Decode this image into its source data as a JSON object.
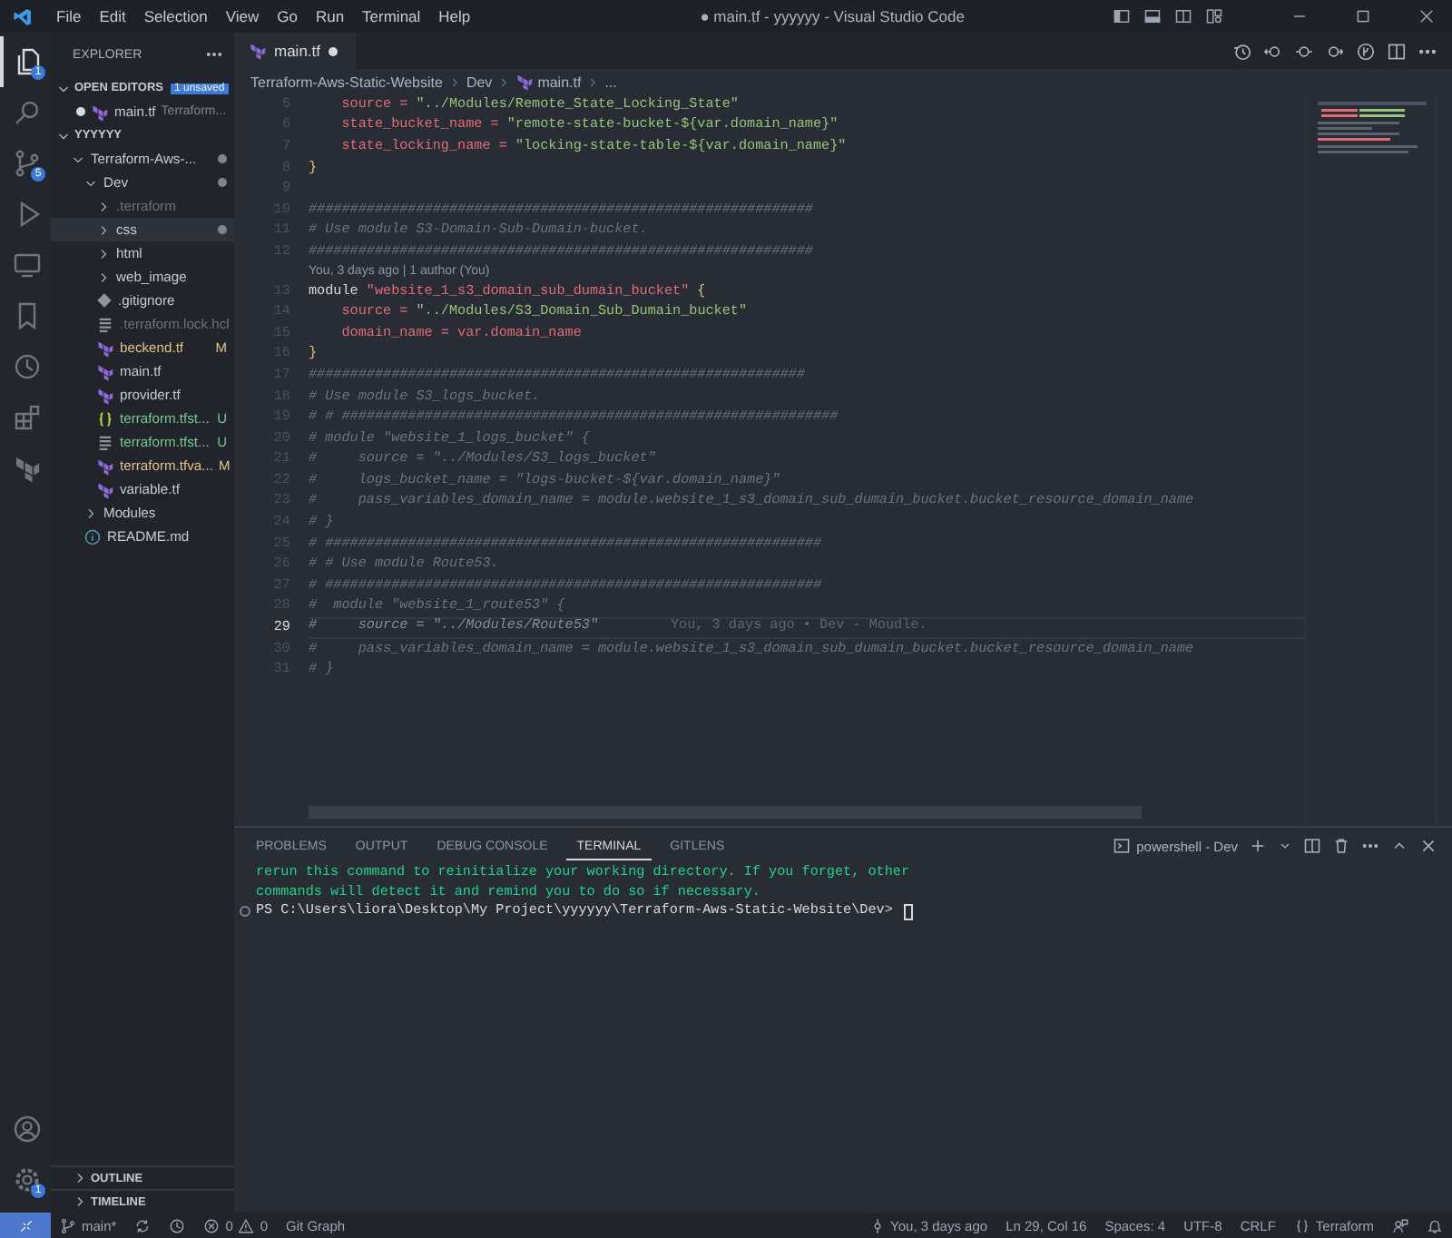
{
  "title_bar": {
    "menu": [
      "File",
      "Edit",
      "Selection",
      "View",
      "Go",
      "Run",
      "Terminal",
      "Help"
    ],
    "title": "● main.tf - yyyyyy - Visual Studio Code"
  },
  "activity_bar": {
    "items": [
      {
        "kind": "explorer",
        "selected": true,
        "badge": "1"
      },
      {
        "kind": "search",
        "selected": false
      },
      {
        "kind": "source-control",
        "selected": false,
        "badge": "5"
      },
      {
        "kind": "run",
        "selected": false
      },
      {
        "kind": "remote",
        "selected": false
      },
      {
        "kind": "bookmarks",
        "selected": false
      },
      {
        "kind": "gitlens",
        "selected": false
      },
      {
        "kind": "extensions",
        "selected": false
      },
      {
        "kind": "terraform",
        "selected": false
      }
    ],
    "bottom": [
      {
        "kind": "accounts"
      },
      {
        "kind": "settings",
        "badge": "1"
      }
    ]
  },
  "sidebar": {
    "title": "EXPLORER",
    "open_editors": {
      "label": "OPEN EDITORS",
      "expanded": true,
      "badge": "1 unsaved",
      "items": [
        {
          "name": "main.tf",
          "description": "Terraform...",
          "modified": true,
          "selected": false
        }
      ]
    },
    "workspace": {
      "label": "YYYYYY",
      "expanded": true,
      "tree": [
        {
          "name": "Terraform-Aws-...",
          "kind": "folder",
          "expanded": true,
          "modified": true,
          "selected": false,
          "children": [
            {
              "name": "Dev",
              "kind": "folder",
              "expanded": true,
              "modified": true,
              "selected": false,
              "children": [
                {
                  "name": ".terraform",
                  "kind": "folder",
                  "expanded": false,
                  "ignored": true,
                  "selected": false
                },
                {
                  "name": "css",
                  "kind": "folder",
                  "expanded": false,
                  "modified": true,
                  "selected": true
                },
                {
                  "name": "html",
                  "kind": "folder",
                  "expanded": false,
                  "selected": false
                },
                {
                  "name": "web_image",
                  "kind": "folder",
                  "expanded": false,
                  "selected": false
                },
                {
                  "name": ".gitignore",
                  "kind": "gitignore",
                  "selected": false
                },
                {
                  "name": ".terraform.lock.hcl",
                  "kind": "document",
                  "ignored": true,
                  "selected": false
                },
                {
                  "name": "beckend.tf",
                  "kind": "terraform",
                  "status": "M",
                  "color": "#e2c08d",
                  "selected": false
                },
                {
                  "name": "main.tf",
                  "kind": "terraform",
                  "selected": false
                },
                {
                  "name": "provider.tf",
                  "kind": "terraform",
                  "selected": false
                },
                {
                  "name": "terraform.tfst...",
                  "kind": "json",
                  "status": "U",
                  "color": "#73c991",
                  "selected": false
                },
                {
                  "name": "terraform.tfst...",
                  "kind": "document",
                  "status": "U",
                  "color": "#73c991",
                  "selected": false
                },
                {
                  "name": "terraform.tfva...",
                  "kind": "terraform",
                  "status": "M",
                  "color": "#e2c08d",
                  "selected": false
                },
                {
                  "name": "variable.tf",
                  "kind": "terraform",
                  "selected": false
                }
              ]
            },
            {
              "name": "Modules",
              "kind": "folder",
              "expanded": false,
              "selected": false
            },
            {
              "name": "README.md",
              "kind": "markdown",
              "selected": false
            }
          ]
        }
      ]
    },
    "outline": {
      "label": "OUTLINE",
      "expanded": false
    },
    "timeline": {
      "label": "TIMELINE",
      "expanded": false
    }
  },
  "editor": {
    "tabs": [
      {
        "name": "main.tf",
        "selected": true,
        "modified": true
      }
    ],
    "breadcrumbs": [
      "Terraform-Aws-Static-Website",
      "Dev",
      "main.tf",
      "..."
    ],
    "lines": [
      {
        "kind": "code",
        "number": "5",
        "current": false,
        "tokens": [
          {
            "kind": "prop",
            "text": "    source"
          },
          {
            "kind": "op",
            "text": " = "
          },
          {
            "kind": "str",
            "text": "\"../Modules/Remote_State_Locking_State\""
          }
        ]
      },
      {
        "kind": "code",
        "number": "6",
        "current": false,
        "tokens": [
          {
            "kind": "prop",
            "text": "    state_bucket_name"
          },
          {
            "kind": "op",
            "text": " = "
          },
          {
            "kind": "str",
            "text": "\"remote-state-bucket-${var.domain_name}\""
          }
        ]
      },
      {
        "kind": "code",
        "number": "7",
        "current": false,
        "tokens": [
          {
            "kind": "prop",
            "text": "    state_locking_name"
          },
          {
            "kind": "op",
            "text": " = "
          },
          {
            "kind": "str",
            "text": "\"locking-state-table-${var.domain_name}\""
          }
        ]
      },
      {
        "kind": "code",
        "number": "8",
        "current": false,
        "tokens": [
          {
            "kind": "brace",
            "text": "}"
          }
        ]
      },
      {
        "kind": "code",
        "number": "9",
        "current": false
      },
      {
        "kind": "code",
        "number": "10",
        "current": false,
        "tokens": [
          {
            "kind": "com",
            "text": "#############################################################"
          }
        ]
      },
      {
        "kind": "code",
        "number": "11",
        "current": false,
        "tokens": [
          {
            "kind": "com",
            "text": "# Use module S3-Domain-Sub-Dumain-bucket."
          }
        ]
      },
      {
        "kind": "code",
        "number": "12",
        "current": false,
        "tokens": [
          {
            "kind": "com",
            "text": "#############################################################"
          }
        ]
      },
      {
        "kind": "codelens",
        "text": "You, 3 days ago | 1 author (You)"
      },
      {
        "kind": "code",
        "number": "13",
        "current": false,
        "tokens": [
          {
            "kind": "kw",
            "text": "module"
          },
          {
            "kind": "prop",
            "text": " \"website_1_s3_domain_sub_dumain_bucket\""
          },
          {
            "kind": "brace",
            "text": " {"
          }
        ]
      },
      {
        "kind": "code",
        "number": "14",
        "current": false,
        "tokens": [
          {
            "kind": "prop",
            "text": "    source"
          },
          {
            "kind": "op",
            "text": " = "
          },
          {
            "kind": "str",
            "text": "\"../Modules/S3_Domain_Sub_Dumain_bucket\""
          }
        ]
      },
      {
        "kind": "code",
        "number": "15",
        "current": false,
        "tokens": [
          {
            "kind": "prop",
            "text": "    domain_name"
          },
          {
            "kind": "op",
            "text": " = "
          },
          {
            "kind": "prop",
            "text": "var.domain_name"
          }
        ]
      },
      {
        "kind": "code",
        "number": "16",
        "current": false,
        "tokens": [
          {
            "kind": "brace",
            "text": "}"
          }
        ]
      },
      {
        "kind": "code",
        "number": "17",
        "current": false,
        "tokens": [
          {
            "kind": "com",
            "text": "############################################################"
          }
        ]
      },
      {
        "kind": "code",
        "number": "18",
        "current": false,
        "tokens": [
          {
            "kind": "com",
            "text": "# Use module S3_logs_bucket."
          }
        ]
      },
      {
        "kind": "code",
        "number": "19",
        "current": false,
        "tokens": [
          {
            "kind": "com",
            "text": "# # ############################################################"
          }
        ]
      },
      {
        "kind": "code",
        "number": "20",
        "current": false,
        "tokens": [
          {
            "kind": "com",
            "text": "# module \"website_1_logs_bucket\" {"
          }
        ]
      },
      {
        "kind": "code",
        "number": "21",
        "current": false,
        "tokens": [
          {
            "kind": "com",
            "text": "#     source = \"../Modules/S3_logs_bucket\""
          }
        ]
      },
      {
        "kind": "code",
        "number": "22",
        "current": false,
        "tokens": [
          {
            "kind": "com",
            "text": "#     logs_bucket_name = \"logs-bucket-${var.domain_name}\""
          }
        ]
      },
      {
        "kind": "code",
        "number": "23",
        "current": false,
        "tokens": [
          {
            "kind": "com",
            "text": "#     pass_variables_domain_name = module.website_1_s3_domain_sub_dumain_bucket.bucket_resource_domain_name"
          }
        ]
      },
      {
        "kind": "code",
        "number": "24",
        "current": false,
        "tokens": [
          {
            "kind": "com",
            "text": "# }"
          }
        ]
      },
      {
        "kind": "code",
        "number": "25",
        "current": false,
        "tokens": [
          {
            "kind": "com",
            "text": "# ############################################################"
          }
        ]
      },
      {
        "kind": "code",
        "number": "26",
        "current": false,
        "tokens": [
          {
            "kind": "com",
            "text": "# # Use module Route53."
          }
        ]
      },
      {
        "kind": "code",
        "number": "27",
        "current": false,
        "tokens": [
          {
            "kind": "com",
            "text": "# ############################################################"
          }
        ]
      },
      {
        "kind": "code",
        "number": "28",
        "current": false,
        "tokens": [
          {
            "kind": "com",
            "text": "#  module \"website_1_route53\" {"
          }
        ]
      },
      {
        "kind": "code",
        "number": "29",
        "current": true,
        "tokens": [
          {
            "kind": "com",
            "text": "#     source = \"../Modules/Route53\""
          }
        ],
        "blame": "You, 3 days ago • Dev - Moudle."
      },
      {
        "kind": "code",
        "number": "30",
        "current": false,
        "tokens": [
          {
            "kind": "com",
            "text": "#     pass_variables_domain_name = module.website_1_s3_domain_sub_dumain_bucket.bucket_resource_domain_name"
          }
        ]
      },
      {
        "kind": "code",
        "number": "31",
        "current": false,
        "tokens": [
          {
            "kind": "com",
            "text": "# }"
          }
        ]
      }
    ]
  },
  "panel": {
    "tabs": [
      {
        "label": "PROBLEMS",
        "selected": false
      },
      {
        "label": "OUTPUT",
        "selected": false
      },
      {
        "label": "DEBUG CONSOLE",
        "selected": false
      },
      {
        "label": "TERMINAL",
        "selected": true
      },
      {
        "label": "GITLENS",
        "selected": false
      }
    ],
    "terminal_name": "powershell - Dev",
    "terminal_lines": [
      {
        "kind": "info",
        "text": "rerun this command to reinitialize your working directory. If you forget, other"
      },
      {
        "kind": "info",
        "text": "commands will detect it and remind you to do so if necessary."
      },
      {
        "kind": "prompt",
        "text": "PS C:\\Users\\liora\\Desktop\\My Project\\yyyyyy\\Terraform-Aws-Static-Website\\Dev>"
      }
    ]
  },
  "status_bar": {
    "branch": "main*",
    "errors": "0",
    "warnings": "0",
    "git_graph": "Git Graph",
    "blame": "You, 3 days ago",
    "position": "Ln 29, Col 16",
    "indent": "Spaces: 4",
    "encoding": "UTF-8",
    "eol": "CRLF",
    "language": "Terraform"
  }
}
